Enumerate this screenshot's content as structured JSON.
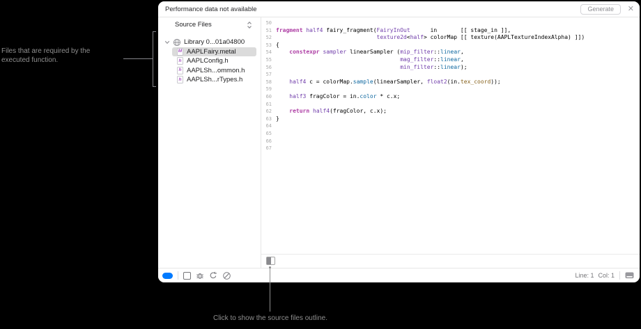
{
  "colors": {
    "accent_blue": "#007AFF",
    "canvas_bg": "#000000",
    "window_bg": "#FFFFFF",
    "selected_row": "#DBDBDB",
    "code_keyword": "#AD3DA4",
    "code_type": "#703DAA",
    "code_value": "#0F68A0",
    "code_property": "#86611B"
  },
  "topbar": {
    "status": "Performance data not available",
    "generate_button": "Generate",
    "close_icon": "✕"
  },
  "sidebar": {
    "header": "Source Files",
    "library": {
      "label": "Library 0...01a04800"
    },
    "files": [
      {
        "label": "AAPLFairy.metal",
        "badge": "M",
        "selected": true
      },
      {
        "label": "AAPLConfig.h",
        "badge": "h",
        "selected": false
      },
      {
        "label": "AAPLSh...ommon.h",
        "badge": "h",
        "selected": false
      },
      {
        "label": "AAPLSh...rTypes.h",
        "badge": "h",
        "selected": false
      }
    ]
  },
  "editor": {
    "lines": [
      {
        "n": 50,
        "segs": []
      },
      {
        "n": 51,
        "segs": [
          {
            "t": "fragment",
            "c": "kw"
          },
          {
            "t": " "
          },
          {
            "t": "half4",
            "c": "type"
          },
          {
            "t": " fairy_fragment("
          },
          {
            "t": "FairyInOut",
            "c": "type"
          },
          {
            "t": "      in       [[ stage_in ]],"
          }
        ]
      },
      {
        "n": 52,
        "segs": [
          {
            "t": "                              "
          },
          {
            "t": "texture2d",
            "c": "type"
          },
          {
            "t": "<"
          },
          {
            "t": "half",
            "c": "type"
          },
          {
            "t": "> colorMap [[ texture(AAPLTextureIndexAlpha) ]])"
          }
        ]
      },
      {
        "n": 53,
        "segs": [
          {
            "t": "{"
          }
        ]
      },
      {
        "n": 54,
        "segs": [
          {
            "t": "    "
          },
          {
            "t": "constexpr",
            "c": "kw"
          },
          {
            "t": " "
          },
          {
            "t": "sampler",
            "c": "type"
          },
          {
            "t": " linearSampler ("
          },
          {
            "t": "mip_filter",
            "c": "type"
          },
          {
            "t": "::"
          },
          {
            "t": "linear",
            "c": "val"
          },
          {
            "t": ","
          }
        ]
      },
      {
        "n": 55,
        "segs": [
          {
            "t": "                                     "
          },
          {
            "t": "mag_filter",
            "c": "type"
          },
          {
            "t": "::"
          },
          {
            "t": "linear",
            "c": "val"
          },
          {
            "t": ","
          }
        ]
      },
      {
        "n": 56,
        "segs": [
          {
            "t": "                                     "
          },
          {
            "t": "min_filter",
            "c": "type"
          },
          {
            "t": "::"
          },
          {
            "t": "linear",
            "c": "val"
          },
          {
            "t": ");"
          }
        ]
      },
      {
        "n": 57,
        "segs": []
      },
      {
        "n": 58,
        "segs": [
          {
            "t": "    "
          },
          {
            "t": "half4",
            "c": "type"
          },
          {
            "t": " c = colorMap."
          },
          {
            "t": "sample",
            "c": "val"
          },
          {
            "t": "(linearSampler, "
          },
          {
            "t": "float2",
            "c": "type"
          },
          {
            "t": "(in."
          },
          {
            "t": "tex_coord",
            "c": "prop"
          },
          {
            "t": "));"
          }
        ]
      },
      {
        "n": 59,
        "segs": []
      },
      {
        "n": 60,
        "segs": [
          {
            "t": "    "
          },
          {
            "t": "half3",
            "c": "type"
          },
          {
            "t": " fragColor = in."
          },
          {
            "t": "color",
            "c": "val"
          },
          {
            "t": " * c.x;"
          }
        ]
      },
      {
        "n": 61,
        "segs": []
      },
      {
        "n": 62,
        "segs": [
          {
            "t": "    "
          },
          {
            "t": "return",
            "c": "kw"
          },
          {
            "t": " "
          },
          {
            "t": "half4",
            "c": "type"
          },
          {
            "t": "(fragColor, c.x);"
          }
        ]
      },
      {
        "n": 63,
        "segs": [
          {
            "t": "}"
          }
        ]
      },
      {
        "n": 64,
        "segs": []
      },
      {
        "n": 65,
        "segs": []
      },
      {
        "n": 66,
        "segs": []
      },
      {
        "n": 67,
        "segs": []
      }
    ]
  },
  "statusbar": {
    "line_label": "Line: 1",
    "col_label": "Col: 1",
    "icons": [
      "breakpoints-pill-icon",
      "viewport-square-icon",
      "debug-bug-icon",
      "reload-icon",
      "gauge-icon",
      "console-icon"
    ]
  },
  "annotations": {
    "left_note": {
      "line1": "Files that are required by the",
      "line2": "executed function."
    },
    "bottom_note": "Click to show the source files outline."
  }
}
